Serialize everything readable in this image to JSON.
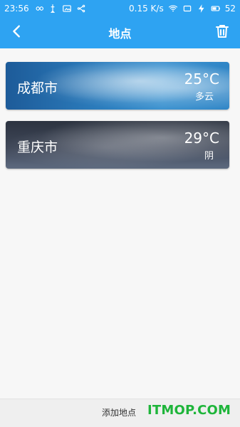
{
  "status_bar": {
    "time": "23:56",
    "data_rate": "0.15",
    "data_rate_unit": "K/s",
    "battery": "52"
  },
  "app_bar": {
    "title": "地点"
  },
  "locations": [
    {
      "city": "成都市",
      "temperature": "25°C",
      "condition": "多云"
    },
    {
      "city": "重庆市",
      "temperature": "29°C",
      "condition": "阴"
    }
  ],
  "bottom_bar": {
    "add_location_label": "添加地点",
    "watermark": "ITMOP.COM"
  },
  "colors": {
    "primary": "#2ea3f2",
    "watermark_green": "#1eb53a"
  },
  "icons": {
    "status_left": [
      "infinity-icon",
      "usb-icon",
      "image-icon",
      "share-icon"
    ],
    "status_right": [
      "wifi-icon",
      "screen-icon",
      "charging-icon",
      "battery-icon"
    ],
    "app_bar_left": "back-arrow-icon",
    "app_bar_right": "trash-icon"
  }
}
